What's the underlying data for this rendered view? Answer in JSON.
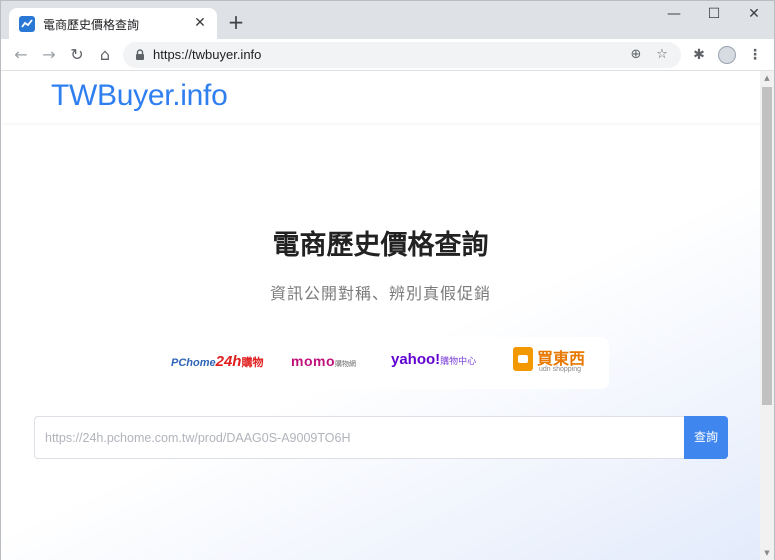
{
  "browser": {
    "tab_title": "電商歷史價格查詢",
    "tab_close": "✕",
    "new_tab": "+",
    "url": "https://twbuyer.info",
    "window_controls": {
      "minimize": "—",
      "maximize": "☐",
      "close": "✕"
    },
    "nav": {
      "back": "←",
      "forward": "→",
      "reload": "↻",
      "home": "⌂"
    },
    "icons": {
      "install": "⊕",
      "star": "☆",
      "extensions": "✱",
      "menu": "⋮"
    }
  },
  "site": {
    "logo": "TWBuyer.info",
    "title": "電商歷史價格查詢",
    "subtitle": "資訊公開對稱、辨別真假促銷",
    "stores": {
      "pchome": {
        "part1": "PChome",
        "part2": "24h",
        "part3": "購物"
      },
      "momo": {
        "part1": "momo",
        "part2": "購物網"
      },
      "yahoo": {
        "part1": "yahoo!",
        "part2": "購物中心"
      },
      "udn": {
        "part1": "買東西",
        "part2": "udn shopping"
      }
    },
    "search": {
      "placeholder": "https://24h.pchome.com.tw/prod/DAAG0S-A9009TO6H",
      "button": "查詢"
    }
  },
  "colors": {
    "brand": "#2f7ff0",
    "button": "#3f86ef"
  }
}
